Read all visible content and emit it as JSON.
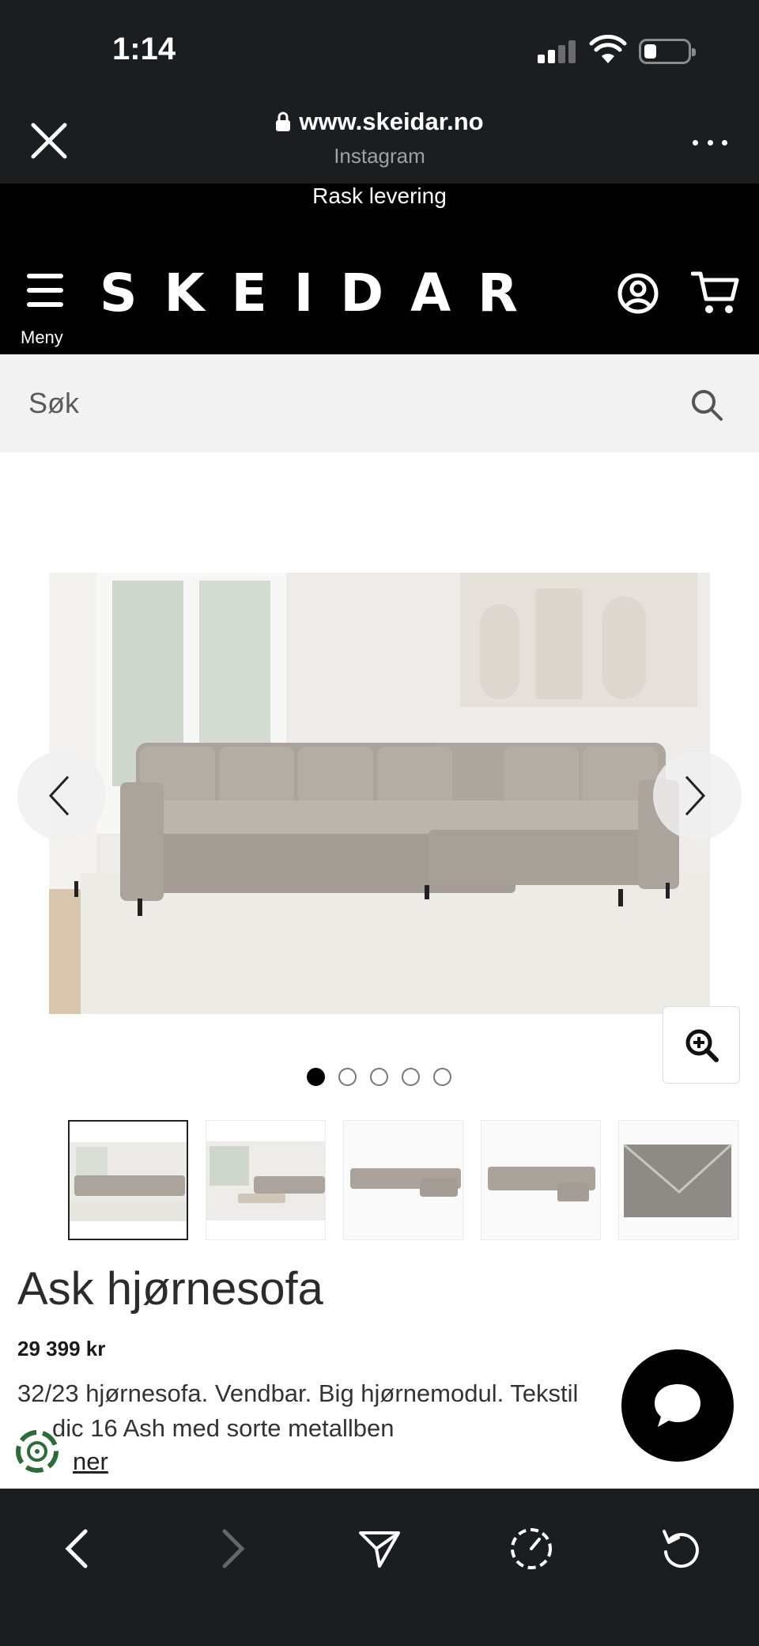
{
  "status_bar": {
    "time": "1:14"
  },
  "browser": {
    "url": "www.skeidar.no",
    "source": "Instagram"
  },
  "site": {
    "promo": "Rask levering",
    "logo": "SKEIDAR",
    "menu_label": "Meny"
  },
  "search": {
    "placeholder": "Søk"
  },
  "product": {
    "title": "Ask hjørnesofa",
    "price": "29 399 kr",
    "description_line1": "32/23 hjørnesofa. Vendbar. Big hjørnemodul. Tekstil",
    "description_line2": "dic 16 Ash med sorte metallben",
    "more_link": "ner",
    "image_count": 5,
    "active_image": 1
  },
  "colors": {
    "chrome": "#1c1d20",
    "header": "#000000",
    "search_bg": "#f2f2f2",
    "sofa": "#a8a29a",
    "leaf_green": "#2e6b3a"
  },
  "icons": [
    "close-icon",
    "lock-icon",
    "more-icon",
    "menu-icon",
    "account-icon",
    "cart-icon",
    "search-icon",
    "chevron-left-icon",
    "chevron-right-icon",
    "zoom-in-icon",
    "chat-icon",
    "leaf-icon",
    "back-icon",
    "forward-icon",
    "share-icon",
    "speed-icon",
    "reload-icon"
  ]
}
